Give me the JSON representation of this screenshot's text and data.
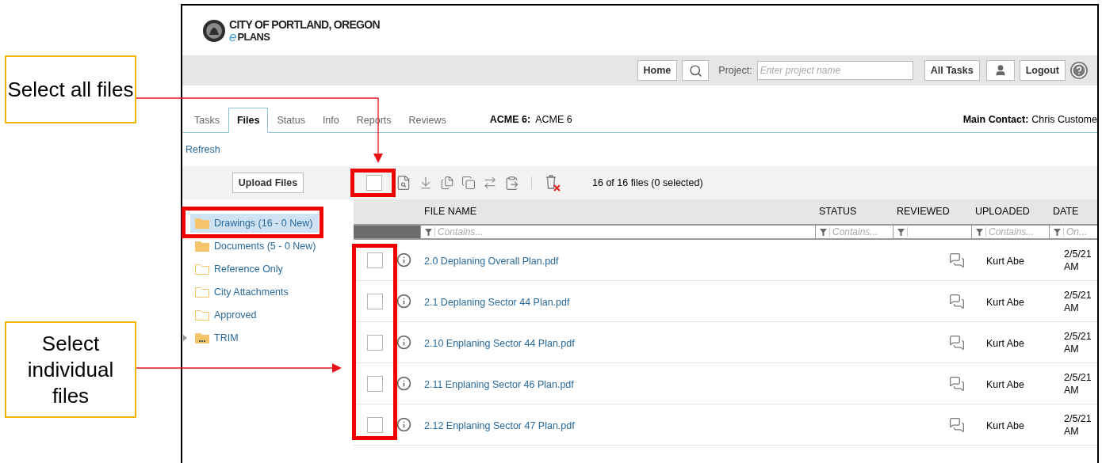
{
  "annotations": [
    {
      "text": "Select all files"
    },
    {
      "text": "Select individual files"
    }
  ],
  "header": {
    "logo_title": "CITY OF PORTLAND, OREGON",
    "logo_e": "e",
    "logo_sub": "PLANS"
  },
  "top_bar": {
    "home": "Home",
    "project_label": "Project:",
    "project_placeholder": "Enter project name",
    "all_tasks": "All Tasks",
    "logout": "Logout"
  },
  "tabs": [
    {
      "label": "Tasks",
      "selected": false
    },
    {
      "label": "Files",
      "selected": true
    },
    {
      "label": "Status",
      "selected": false
    },
    {
      "label": "Info",
      "selected": false
    },
    {
      "label": "Reports",
      "selected": false
    },
    {
      "label": "Reviews",
      "selected": false
    }
  ],
  "project": {
    "label": "ACME 6:",
    "value": "ACME 6"
  },
  "main_contact": {
    "label": "Main Contact:",
    "value": "Chris Custome"
  },
  "refresh": "Refresh",
  "upload_button": "Upload Files",
  "select_all": {
    "checked": false
  },
  "file_count": "16 of 16 files (0 selected)",
  "folders": [
    {
      "name": "Drawings (16 - 0 New)",
      "kind": "filled",
      "selected": true
    },
    {
      "name": "Documents (5 - 0 New)",
      "kind": "filled",
      "selected": false
    },
    {
      "name": "Reference Only",
      "kind": "empty",
      "selected": false
    },
    {
      "name": "City Attachments",
      "kind": "empty",
      "selected": false
    },
    {
      "name": "Approved",
      "kind": "empty",
      "selected": false
    },
    {
      "name": "TRIM",
      "kind": "group",
      "selected": false
    }
  ],
  "table": {
    "columns": [
      "FILE NAME",
      "STATUS",
      "REVIEWED",
      "UPLOADED",
      "DATE"
    ],
    "filters": [
      {
        "kind": "text",
        "placeholder": "Contains..."
      },
      {
        "kind": "text",
        "placeholder": "Contains..."
      },
      {
        "kind": "select"
      },
      {
        "kind": "text",
        "placeholder": "Contains..."
      },
      {
        "kind": "text",
        "placeholder": "On..."
      }
    ],
    "rows": [
      {
        "name": "2.0 Deplaning Overall Plan.pdf",
        "checked": false,
        "uploaded": "Kurt Abe",
        "date": "2/5/21",
        "time": "AM"
      },
      {
        "name": "2.1 Deplaning Sector 44 Plan.pdf",
        "checked": false,
        "uploaded": "Kurt Abe",
        "date": "2/5/21",
        "time": "AM"
      },
      {
        "name": "2.10 Enplaning Sector 44 Plan.pdf",
        "checked": false,
        "uploaded": "Kurt Abe",
        "date": "2/5/21",
        "time": "AM"
      },
      {
        "name": "2.11 Enplaning Sector 46 Plan.pdf",
        "checked": false,
        "uploaded": "Kurt Abe",
        "date": "2/5/21",
        "time": "AM"
      },
      {
        "name": "2.12 Enplaning Sector 47 Plan.pdf",
        "checked": false,
        "uploaded": "Kurt Abe",
        "date": "2/5/21",
        "time": "AM"
      }
    ]
  }
}
